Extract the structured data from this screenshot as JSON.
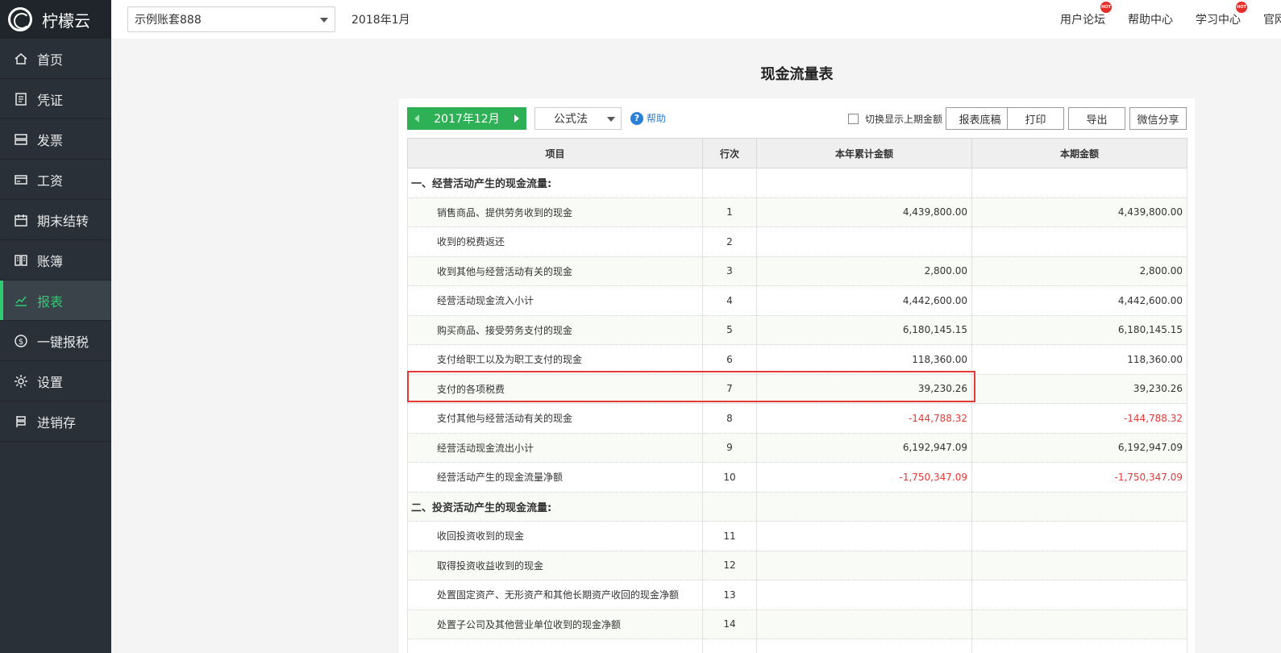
{
  "app": {
    "name": "柠檬云"
  },
  "sidebar": {
    "items": [
      {
        "label": "首页",
        "icon": "home-icon",
        "active": false
      },
      {
        "label": "凭证",
        "icon": "voucher-icon",
        "active": false
      },
      {
        "label": "发票",
        "icon": "invoice-icon",
        "active": false
      },
      {
        "label": "工资",
        "icon": "salary-card-icon",
        "active": false
      },
      {
        "label": "期末结转",
        "icon": "calendar-icon",
        "active": false
      },
      {
        "label": "账簿",
        "icon": "ledger-book-icon",
        "active": false
      },
      {
        "label": "报表",
        "icon": "chart-line-icon",
        "active": true
      },
      {
        "label": "一键报税",
        "icon": "tax-coin-icon",
        "active": false
      },
      {
        "label": "设置",
        "icon": "gear-icon",
        "active": false
      },
      {
        "label": "进销存",
        "icon": "inventory-icon",
        "active": false
      }
    ]
  },
  "header": {
    "account": "示例账套888",
    "period": "2018年1月",
    "links": [
      {
        "label": "用户论坛",
        "hot": true
      },
      {
        "label": "帮助中心",
        "hot": false
      },
      {
        "label": "学习中心",
        "hot": true
      },
      {
        "label": "官网",
        "hot": false
      }
    ],
    "hot_badge": "HOT"
  },
  "report": {
    "title": "现金流量表",
    "period": "2017年12月",
    "method": "公式法",
    "help": "帮助",
    "toggle_label": "切换显示上期金额",
    "buttons": {
      "draft": "报表底稿",
      "print": "打印",
      "export": "导出",
      "share": "微信分享"
    },
    "columns": [
      "项目",
      "行次",
      "本年累计金额",
      "本期金额"
    ],
    "rows": [
      {
        "item": "一、经营活动产生的现金流量:",
        "line": "",
        "ytd": "",
        "period": "",
        "section": true
      },
      {
        "item": "销售商品、提供劳务收到的现金",
        "line": "1",
        "ytd": "4,439,800.00",
        "period": "4,439,800.00"
      },
      {
        "item": "收到的税费返还",
        "line": "2",
        "ytd": "",
        "period": ""
      },
      {
        "item": "收到其他与经营活动有关的现金",
        "line": "3",
        "ytd": "2,800.00",
        "period": "2,800.00"
      },
      {
        "item": "经营活动现金流入小计",
        "line": "4",
        "ytd": "4,442,600.00",
        "period": "4,442,600.00"
      },
      {
        "item": "购买商品、接受劳务支付的现金",
        "line": "5",
        "ytd": "6,180,145.15",
        "period": "6,180,145.15"
      },
      {
        "item": "支付给职工以及为职工支付的现金",
        "line": "6",
        "ytd": "118,360.00",
        "period": "118,360.00"
      },
      {
        "item": "支付的各项税费",
        "line": "7",
        "ytd": "39,230.26",
        "period": "39,230.26"
      },
      {
        "item": "支付其他与经营活动有关的现金",
        "line": "8",
        "ytd": "-144,788.32",
        "period": "-144,788.32",
        "negative": true
      },
      {
        "item": "经营活动现金流出小计",
        "line": "9",
        "ytd": "6,192,947.09",
        "period": "6,192,947.09"
      },
      {
        "item": "经营活动产生的现金流量净额",
        "line": "10",
        "ytd": "-1,750,347.09",
        "period": "-1,750,347.09",
        "negative": true
      },
      {
        "item": "二、投资活动产生的现金流量:",
        "line": "",
        "ytd": "",
        "period": "",
        "section": true
      },
      {
        "item": "收回投资收到的现金",
        "line": "11",
        "ytd": "",
        "period": ""
      },
      {
        "item": "取得投资收益收到的现金",
        "line": "12",
        "ytd": "",
        "period": ""
      },
      {
        "item": "处置固定资产、无形资产和其他长期资产收回的现金净额",
        "line": "13",
        "ytd": "",
        "period": ""
      },
      {
        "item": "处置子公司及其他营业单位收到的现金净额",
        "line": "14",
        "ytd": "",
        "period": ""
      },
      {
        "item": "",
        "line": "",
        "ytd": "",
        "period": ""
      }
    ]
  },
  "colors": {
    "accent": "#2eb156",
    "sidebar_bg": "#293038",
    "negative": "#e53935",
    "highlight": "#e53935"
  }
}
